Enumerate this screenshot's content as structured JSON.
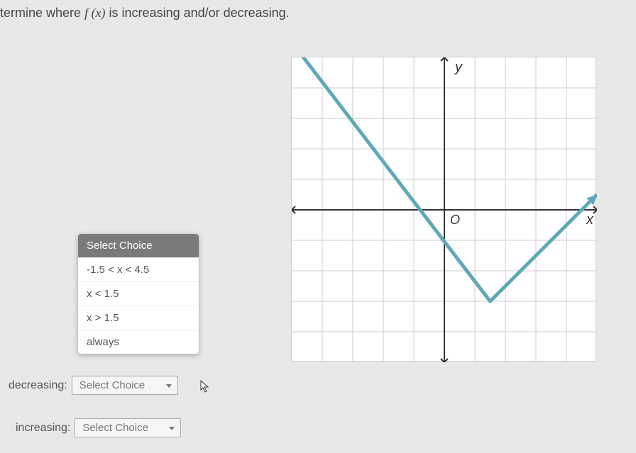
{
  "question": {
    "prefix": "termine where ",
    "fx": "f (x)",
    "suffix": " is increasing and/or decreasing."
  },
  "dropdown": {
    "header": "Select Choice",
    "options": [
      "-1.5 < x < 4.5",
      "x < 1.5",
      "x > 1.5",
      "always"
    ]
  },
  "fields": {
    "decreasing_label": "decreasing:",
    "increasing_label": "increasing:",
    "placeholder": "Select Choice"
  },
  "graph": {
    "x_label": "x",
    "y_label": "y",
    "origin_label": "O"
  },
  "chart_data": {
    "type": "line",
    "title": "",
    "xlabel": "x",
    "ylabel": "y",
    "xlim": [
      -5,
      5
    ],
    "ylim": [
      -5,
      5
    ],
    "series": [
      {
        "name": "f(x)",
        "x": [
          -5,
          1.5,
          5
        ],
        "y": [
          5.5,
          -3,
          0.5
        ]
      }
    ],
    "annotations": [
      "O"
    ],
    "grid": true,
    "vertex": {
      "x": 1.5,
      "y": -3
    }
  }
}
